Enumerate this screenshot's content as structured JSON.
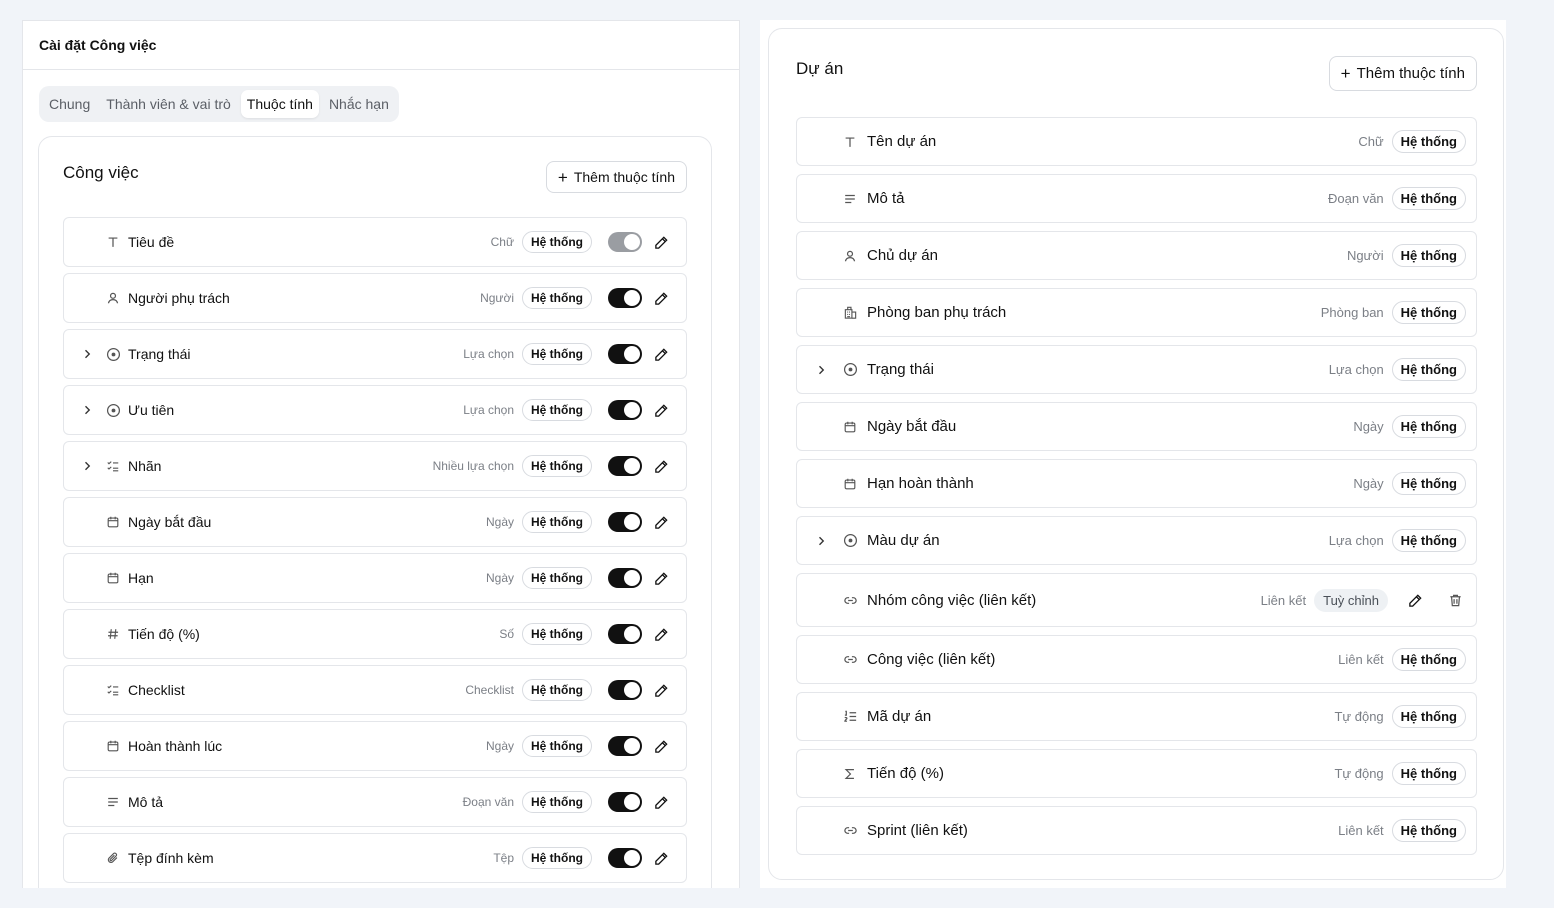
{
  "settings": {
    "title": "Cài đặt Công việc",
    "tabs": [
      "Chung",
      "Thành viên & vai trò",
      "Thuộc tính",
      "Nhắc hạn"
    ],
    "active_tab": "Thuộc tính"
  },
  "task_card": {
    "title": "Công việc",
    "add_label": "Thêm thuộc tính",
    "rows": [
      {
        "name": "Tiêu đề",
        "type": "Chữ",
        "badge": "Hệ thống",
        "icon": "text-icon",
        "expandable": false,
        "toggle": "disabled-on"
      },
      {
        "name": "Người phụ trách",
        "type": "Người",
        "badge": "Hệ thống",
        "icon": "person-icon",
        "expandable": false,
        "toggle": "on"
      },
      {
        "name": "Trạng thái",
        "type": "Lựa chọn",
        "badge": "Hệ thống",
        "icon": "select-icon",
        "expandable": true,
        "toggle": "on"
      },
      {
        "name": "Ưu tiên",
        "type": "Lựa chọn",
        "badge": "Hệ thống",
        "icon": "select-icon",
        "expandable": true,
        "toggle": "on"
      },
      {
        "name": "Nhãn",
        "type": "Nhiều lựa chọn",
        "badge": "Hệ thống",
        "icon": "checklist-icon",
        "expandable": true,
        "toggle": "on"
      },
      {
        "name": "Ngày bắt đầu",
        "type": "Ngày",
        "badge": "Hệ thống",
        "icon": "calendar-icon",
        "expandable": false,
        "toggle": "on"
      },
      {
        "name": "Hạn",
        "type": "Ngày",
        "badge": "Hệ thống",
        "icon": "calendar-icon",
        "expandable": false,
        "toggle": "on"
      },
      {
        "name": "Tiến độ (%)",
        "type": "Số",
        "badge": "Hệ thống",
        "icon": "hash-icon",
        "expandable": false,
        "toggle": "on"
      },
      {
        "name": "Checklist",
        "type": "Checklist",
        "badge": "Hệ thống",
        "icon": "checklist-icon",
        "expandable": false,
        "toggle": "on"
      },
      {
        "name": "Hoàn thành lúc",
        "type": "Ngày",
        "badge": "Hệ thống",
        "icon": "calendar-icon",
        "expandable": false,
        "toggle": "on"
      },
      {
        "name": "Mô tả",
        "type": "Đoạn văn",
        "badge": "Hệ thống",
        "icon": "paragraph-icon",
        "expandable": false,
        "toggle": "on"
      },
      {
        "name": "Tệp đính kèm",
        "type": "Tệp",
        "badge": "Hệ thống",
        "icon": "paperclip-icon",
        "expandable": false,
        "toggle": "on"
      }
    ]
  },
  "project_card": {
    "title": "Dự án",
    "add_label": "Thêm thuộc tính",
    "rows": [
      {
        "name": "Tên dự án",
        "type": "Chữ",
        "badge": "Hệ thống",
        "icon": "text-icon",
        "expandable": false,
        "custom": false
      },
      {
        "name": "Mô tả",
        "type": "Đoạn văn",
        "badge": "Hệ thống",
        "icon": "paragraph-icon",
        "expandable": false,
        "custom": false
      },
      {
        "name": "Chủ dự án",
        "type": "Người",
        "badge": "Hệ thống",
        "icon": "person-icon",
        "expandable": false,
        "custom": false
      },
      {
        "name": "Phòng ban phụ trách",
        "type": "Phòng ban",
        "badge": "Hệ thống",
        "icon": "building-icon",
        "expandable": false,
        "custom": false
      },
      {
        "name": "Trạng thái",
        "type": "Lựa chọn",
        "badge": "Hệ thống",
        "icon": "select-icon",
        "expandable": true,
        "custom": false
      },
      {
        "name": "Ngày bắt đầu",
        "type": "Ngày",
        "badge": "Hệ thống",
        "icon": "calendar-icon",
        "expandable": false,
        "custom": false
      },
      {
        "name": "Hạn hoàn thành",
        "type": "Ngày",
        "badge": "Hệ thống",
        "icon": "calendar-icon",
        "expandable": false,
        "custom": false
      },
      {
        "name": "Màu dự án",
        "type": "Lựa chọn",
        "badge": "Hệ thống",
        "icon": "select-icon",
        "expandable": true,
        "custom": false
      },
      {
        "name": "Nhóm công việc (liên kết)",
        "type": "Liên kết",
        "badge": "Tuỳ chỉnh",
        "icon": "link-icon",
        "expandable": false,
        "custom": true
      },
      {
        "name": "Công việc (liên kết)",
        "type": "Liên kết",
        "badge": "Hệ thống",
        "icon": "link-icon",
        "expandable": false,
        "custom": false
      },
      {
        "name": "Mã dự án",
        "type": "Tự động",
        "badge": "Hệ thống",
        "icon": "numbered-list-icon",
        "expandable": false,
        "custom": false
      },
      {
        "name": "Tiến độ (%)",
        "type": "Tự động",
        "badge": "Hệ thống",
        "icon": "sigma-icon",
        "expandable": false,
        "custom": false
      },
      {
        "name": "Sprint (liên kết)",
        "type": "Liên kết",
        "badge": "Hệ thống",
        "icon": "link-icon",
        "expandable": false,
        "custom": false
      }
    ]
  }
}
